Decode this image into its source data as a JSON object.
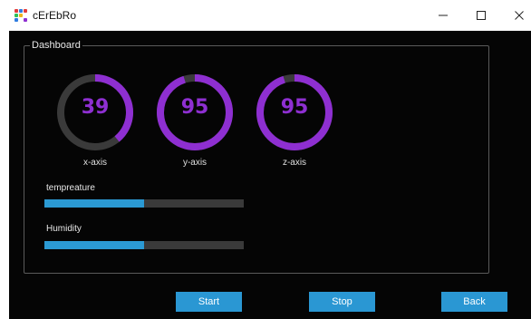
{
  "window": {
    "title": "cErEbRo",
    "minimize_icon": "minimize-icon",
    "maximize_icon": "maximize-icon",
    "close_icon": "close-icon"
  },
  "dashboard": {
    "legend": "Dashboard",
    "gauges": [
      {
        "label": "x-axis",
        "value": "39",
        "fill": 0.39
      },
      {
        "label": "y-axis",
        "value": "95",
        "fill": 0.95
      },
      {
        "label": "z-axis",
        "value": "95",
        "fill": 0.95
      }
    ],
    "bars": [
      {
        "label": "tempreature",
        "fill": 0.5
      },
      {
        "label": "Humidity",
        "fill": 0.5
      }
    ]
  },
  "buttons": {
    "start": "Start",
    "stop": "Stop",
    "back": "Back"
  },
  "colors": {
    "gauge_accent": "#8e2fd1",
    "gauge_track": "#3a3a3a",
    "bar_fill": "#2b9ad4",
    "bar_track": "#3a3a3a",
    "button": "#2a97d3",
    "background": "#050505"
  }
}
